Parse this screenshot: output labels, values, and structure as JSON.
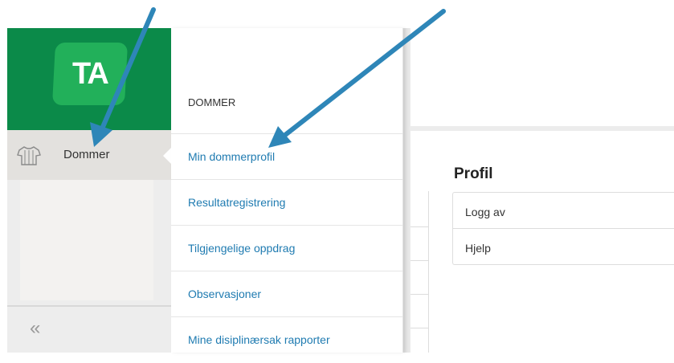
{
  "brand": {
    "logo_text": "TA",
    "color": "#0b8a49"
  },
  "sidebar": {
    "active_item": {
      "label": "Dommer",
      "icon": "shirt-icon"
    },
    "collapse_icon": "«"
  },
  "menu": {
    "heading": "DOMMER",
    "items": [
      {
        "label": "Min dommerprofil"
      },
      {
        "label": "Resultatregistrering"
      },
      {
        "label": "Tilgjengelige oppdrag"
      },
      {
        "label": "Observasjoner"
      },
      {
        "label": "Mine disiplinærsak rapporter"
      }
    ],
    "link_color": "#1f7bb1"
  },
  "profile": {
    "title": "Profil",
    "items": [
      {
        "label": "Logg av"
      },
      {
        "label": "Hjelp"
      }
    ]
  },
  "annotation": {
    "arrow_color": "#2e86b8"
  }
}
